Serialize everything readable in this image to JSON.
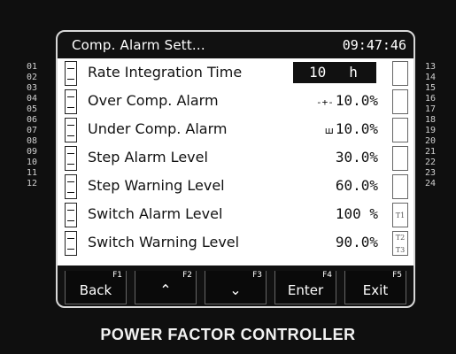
{
  "title": "Comp. Alarm Sett...",
  "clock": "09:47:46",
  "left_numbers": [
    "01",
    "02",
    "03",
    "04",
    "05",
    "06",
    "07",
    "08",
    "09",
    "10",
    "11",
    "12"
  ],
  "right_numbers": [
    "13",
    "14",
    "15",
    "16",
    "17",
    "18",
    "19",
    "20",
    "21",
    "22",
    "23",
    "24"
  ],
  "rows": [
    {
      "label": "Rate Integration Time",
      "value": "10",
      "unit": "h",
      "prefix": ""
    },
    {
      "label": "Over Comp. Alarm",
      "value": "10.0%",
      "unit": "",
      "prefix": "-+-"
    },
    {
      "label": "Under Comp. Alarm",
      "value": "10.0%",
      "unit": "",
      "prefix": "ꟺ"
    },
    {
      "label": "Step Alarm Level",
      "value": "30.0%",
      "unit": "",
      "prefix": ""
    },
    {
      "label": "Step Warning Level",
      "value": "60.0%",
      "unit": "",
      "prefix": ""
    },
    {
      "label": "Switch Alarm Level",
      "value": "100 %",
      "unit": "",
      "prefix": ""
    },
    {
      "label": "Switch Warning Level",
      "value": "90.0%",
      "unit": "",
      "prefix": ""
    }
  ],
  "right_tags": [
    "T1",
    "T2",
    "T3"
  ],
  "fkeys": [
    {
      "fn": "F1",
      "label": "Back",
      "glyph": ""
    },
    {
      "fn": "F2",
      "label": "",
      "glyph": "⌃"
    },
    {
      "fn": "F3",
      "label": "",
      "glyph": "⌄"
    },
    {
      "fn": "F4",
      "label": "Enter",
      "glyph": ""
    },
    {
      "fn": "F5",
      "label": "Exit",
      "glyph": ""
    }
  ],
  "caption": "POWER FACTOR CONTROLLER"
}
